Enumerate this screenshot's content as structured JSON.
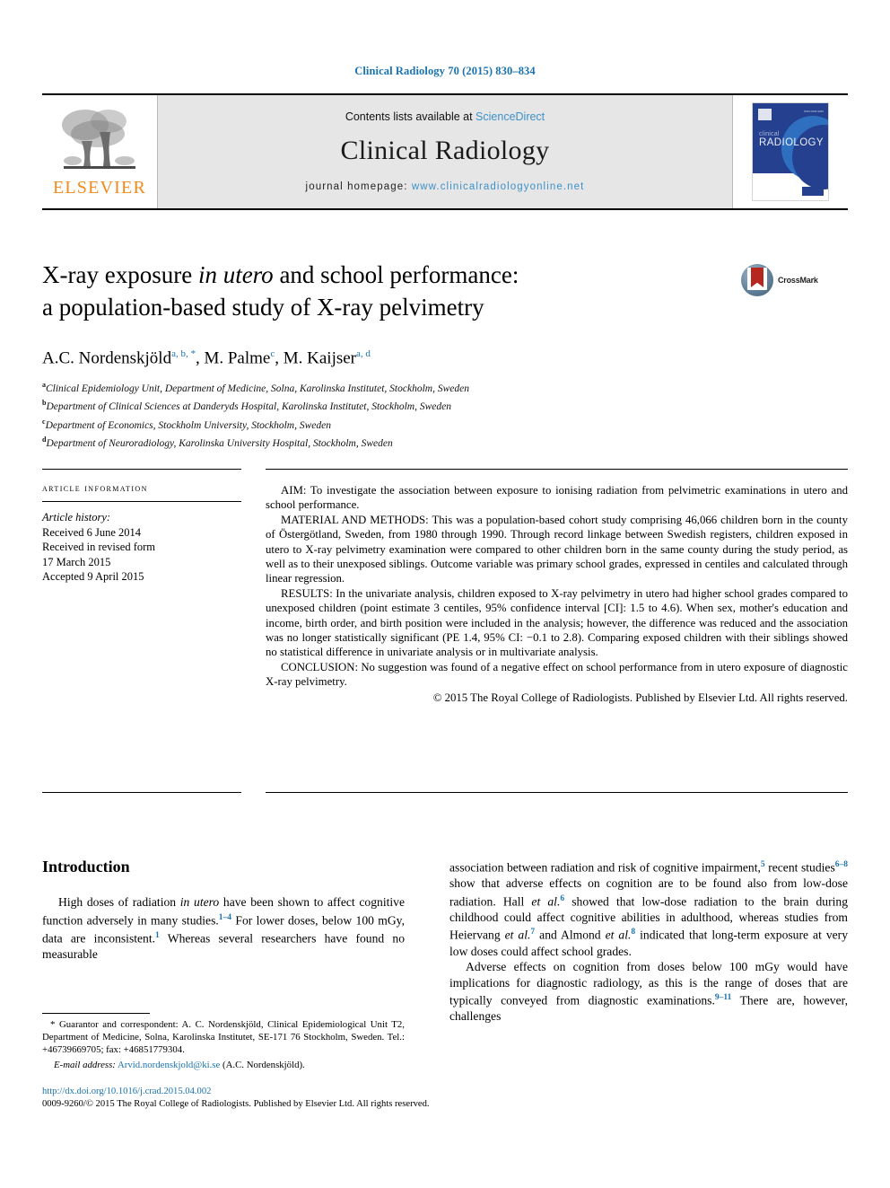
{
  "running_head": "Clinical Radiology 70 (2015) 830–834",
  "masthead": {
    "publisher_logo_label": "ELSEVIER",
    "contents_prefix": "Contents lists available at ",
    "contents_link": "ScienceDirect",
    "journal_title": "Clinical Radiology",
    "homepage_prefix": "journal homepage: ",
    "homepage_url": "www.clinicalradiologyonline.net",
    "cover": {
      "line1": "clinical",
      "line2": "RADIOLOGY",
      "corner_code": "ISSN 0009-9260"
    }
  },
  "article": {
    "title_line1_a": "X-ray exposure ",
    "title_line1_italic": "in utero",
    "title_line1_b": " and school performance:",
    "title_line2": "a population-based study of X-ray pelvimetry",
    "crossmark_label": "CrossMark",
    "authors": [
      {
        "name": "A.C. Nordenskjöld",
        "marks": "a, b, *"
      },
      {
        "name": "M. Palme",
        "marks": "c"
      },
      {
        "name": "M. Kaijser",
        "marks": "a, d"
      }
    ],
    "affiliations": [
      {
        "mark": "a",
        "text": "Clinical Epidemiology Unit, Department of Medicine, Solna, Karolinska Institutet, Stockholm, Sweden"
      },
      {
        "mark": "b",
        "text": "Department of Clinical Sciences at Danderyds Hospital, Karolinska Institutet, Stockholm, Sweden"
      },
      {
        "mark": "c",
        "text": "Department of Economics, Stockholm University, Stockholm, Sweden"
      },
      {
        "mark": "d",
        "text": "Department of Neuroradiology, Karolinska University Hospital, Stockholm, Sweden"
      }
    ]
  },
  "article_information": {
    "heading": "ARTICLE INFORMATION",
    "history_label": "Article history:",
    "history_lines": [
      "Received 6 June 2014",
      "Received in revised form",
      "17 March 2015",
      "Accepted 9 April 2015"
    ]
  },
  "abstract": {
    "aim_label": "AIM:",
    "aim_text": " To investigate the association between exposure to ionising radiation from pelvimetric examinations in utero and school performance.",
    "methods_label": "MATERIAL AND METHODS:",
    "methods_text": " This was a population-based cohort study comprising 46,066 children born in the county of Östergötland, Sweden, from 1980 through 1990. Through record linkage between Swedish registers, children exposed in utero to X-ray pelvimetry examination were compared to other children born in the same county during the study period, as well as to their unexposed siblings. Outcome variable was primary school grades, expressed in centiles and calculated through linear regression.",
    "results_label": "RESULTS:",
    "results_text": " In the univariate analysis, children exposed to X-ray pelvimetry in utero had higher school grades compared to unexposed children (point estimate 3 centiles, 95% confidence interval [CI]: 1.5 to 4.6). When sex, mother's education and income, birth order, and birth position were included in the analysis; however, the difference was reduced and the association was no longer statistically significant (PE 1.4, 95% CI: −0.1 to 2.8). Comparing exposed children with their siblings showed no statistical difference in univariate analysis or in multivariate analysis.",
    "conclusion_label": "CONCLUSION:",
    "conclusion_text": " No suggestion was found of a negative effect on school performance from in utero exposure of diagnostic X-ray pelvimetry.",
    "copyright": "© 2015 The Royal College of Radiologists. Published by Elsevier Ltd. All rights reserved."
  },
  "body": {
    "introduction_heading": "Introduction",
    "left_paragraph_1": {
      "seg1": "High doses of radiation ",
      "ital1": "in utero",
      "seg2": " have been shown to affect cognitive function adversely in many studies.",
      "ref1": "1–4",
      "seg3": " For lower doses, below 100 mGy, data are inconsistent.",
      "ref2": "1",
      "seg4": " Whereas several researchers have found no measurable"
    },
    "right_paragraph_1": {
      "seg1": "association between radiation and risk of cognitive impairment,",
      "ref1": "5",
      "seg2": " recent studies",
      "ref2": "6–8",
      "seg3": " show that adverse effects on cognition are to be found also from low-dose radiation. Hall ",
      "ital1": "et al.",
      "ref3": "6",
      "seg4": " showed that low-dose radiation to the brain during childhood could affect cognitive abilities in adulthood, whereas studies from Heiervang ",
      "ital2": "et al.",
      "ref4": "7",
      "seg5": " and Almond ",
      "ital3": "et al.",
      "ref5": "8",
      "seg6": " indicated that long-term exposure at very low doses could affect school grades."
    },
    "right_paragraph_2": {
      "seg1": "Adverse effects on cognition from doses below 100 mGy would have implications for diagnostic radiology, as this is the range of doses that are typically conveyed from diagnostic examinations.",
      "ref1": "9–11",
      "seg2": " There are, however, challenges"
    }
  },
  "footnote": {
    "star_text": "* Guarantor and correspondent: A. C. Nordenskjöld, Clinical Epidemiological Unit T2, Department of Medicine, Solna, Karolinska Institutet, SE-171 76 Stockholm, Sweden. Tel.: +46739669705; fax: +46851779304.",
    "email_label": "E-mail address:",
    "email_address": "Arvid.nordenskjold@ki.se",
    "email_owner": " (A.C. Nordenskjöld)."
  },
  "bottom": {
    "doi": "http://dx.doi.org/10.1016/j.crad.2015.04.002",
    "copyright_line": "0009-9260/© 2015 The Royal College of Radiologists. Published by Elsevier Ltd. All rights reserved."
  }
}
